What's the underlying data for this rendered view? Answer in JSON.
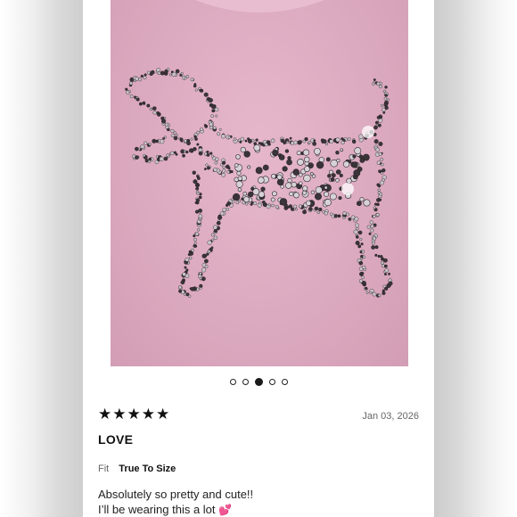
{
  "review": {
    "rating": "★★★★★",
    "rating_value": 5,
    "date": "Jan 03, 2026",
    "title": "LOVE",
    "fit_label": "Fit",
    "fit_value": "True To Size",
    "body_line1": "Absolutely so pretty and cute!!",
    "body_line2": "I’ll be wearing this a lot",
    "emoji": "💕"
  },
  "carousel": {
    "count": 5,
    "active_index": 2
  },
  "colors": {
    "sweatshirt_pink": "#dcaac0",
    "accent_heart": "#e84393",
    "text_primary": "#111111",
    "text_secondary": "#666666"
  }
}
